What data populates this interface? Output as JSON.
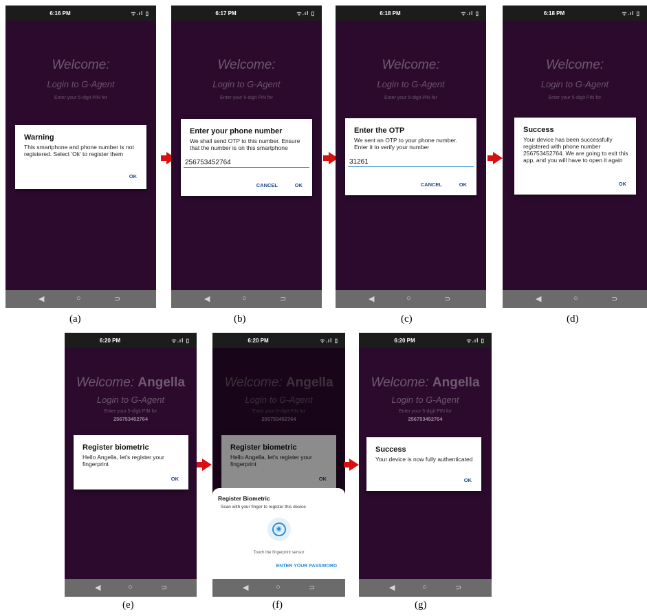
{
  "common": {
    "welcome": "Welcome:",
    "user_name": "Angella",
    "login": "Login to G-Agent",
    "pin_prompt": "Enter your 5-digit PIN for",
    "pin_number": "256753452764",
    "ok": "OK",
    "cancel": "CANCEL",
    "status_icons": "ᯤ.ıl ▯"
  },
  "screens": {
    "a": {
      "time": "6:16 PM",
      "caption": "(a)",
      "title": "Warning",
      "body": "This smartphone and phone number is not registered. Select 'Ok' to register them"
    },
    "b": {
      "time": "6:17 PM",
      "caption": "(b)",
      "title": "Enter your phone number",
      "body": "We shall send OTP to this number. Ensure that the number is on this smartphone",
      "input": "256753452764"
    },
    "c": {
      "time": "6:18 PM",
      "caption": "(c)",
      "title": "Enter the OTP",
      "body": "We sent an OTP to your phone number. Enter it to verify your number",
      "input": "31261"
    },
    "d": {
      "time": "6:18 PM",
      "caption": "(d)",
      "title": "Success",
      "body": "Your device has been successfully registered with phone number 256753452764. We are going to exit this app, and you will have to open it again"
    },
    "e": {
      "time": "6:20 PM",
      "caption": "(e)",
      "title": "Register biometric",
      "body": "Hello Angella, let's register your fingerprint"
    },
    "f": {
      "time": "6:20 PM",
      "caption": "(f)",
      "title": "Register biometric",
      "body": "Hello Angella, let's register your fingerprint",
      "sheet_title": "Register Biometric",
      "sheet_body": "Scan with your finger to register this device",
      "sheet_hint": "Touch the fingerprint sensor",
      "sheet_button": "ENTER YOUR PASSWORD"
    },
    "g": {
      "time": "6:20 PM",
      "caption": "(g)",
      "title": "Success",
      "body": "Your device is now fully authenticated"
    }
  }
}
